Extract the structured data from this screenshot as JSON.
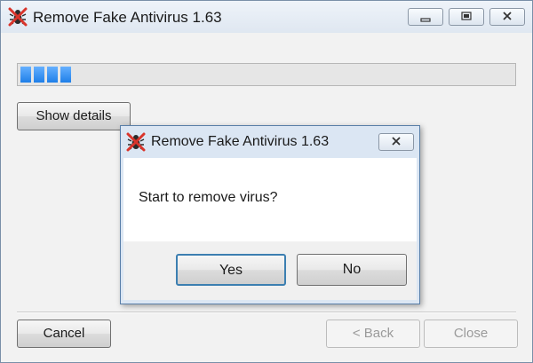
{
  "window": {
    "title": "Remove Fake Antivirus 1.63",
    "progress_percent": 15,
    "show_details_label": "Show details",
    "buttons": {
      "cancel_label": "Cancel",
      "back_label": "< Back",
      "close_label": "Close"
    },
    "caption_buttons": [
      "minimize-icon",
      "restore-icon",
      "close-icon"
    ]
  },
  "dialog": {
    "title": "Remove Fake Antivirus 1.63",
    "message": "Start to remove virus?",
    "yes_label": "Yes",
    "no_label": "No"
  },
  "icons": {
    "app": "no-bug-icon"
  },
  "colors": {
    "progress_fill": "#1f7fe8",
    "title_bar": "#dfe7f1",
    "close_x": "#d9342b"
  }
}
